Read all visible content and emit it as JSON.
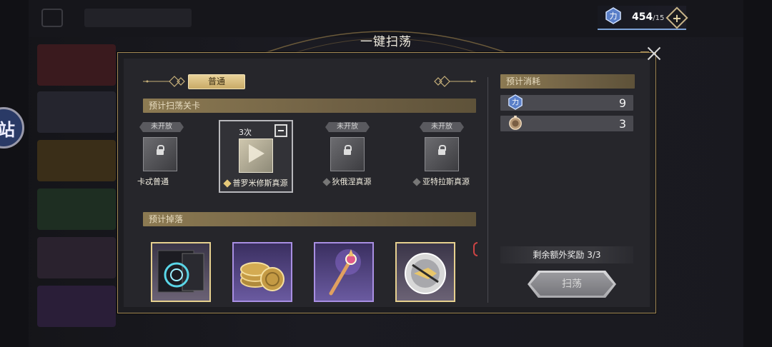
{
  "background": {
    "sticker_text": "站"
  },
  "resource": {
    "current": "454",
    "max": "/15",
    "icon": "stamina-crystal-icon"
  },
  "modal": {
    "title": "一键扫荡",
    "close_icon": "close-icon"
  },
  "tabs": {
    "normal_label": "普通"
  },
  "stages_section": {
    "title": "预计扫荡关卡",
    "stages": [
      {
        "status": "未开放",
        "name": "卡忒普通",
        "locked": true
      },
      {
        "count": "3次",
        "name": "普罗米修斯真源",
        "selected": true
      },
      {
        "status": "未开放",
        "name": "狄俄涅真源",
        "locked": true
      },
      {
        "status": "未开放",
        "name": "亚特拉斯真源",
        "locked": true
      }
    ]
  },
  "drops_section": {
    "title": "预计掉落",
    "items": [
      {
        "icon": "chip-module-icon"
      },
      {
        "icon": "gold-coins-icon"
      },
      {
        "icon": "scepter-icon"
      },
      {
        "icon": "silver-orb-icon"
      }
    ]
  },
  "cost_section": {
    "title": "预计消耗",
    "rows": [
      {
        "icon": "stamina-crystal-icon",
        "value": "9"
      },
      {
        "icon": "pocket-watch-icon",
        "value": "3"
      }
    ]
  },
  "bonus": {
    "text": "剩余额外奖励  3/3"
  },
  "sweep_button": {
    "label": "扫荡"
  }
}
